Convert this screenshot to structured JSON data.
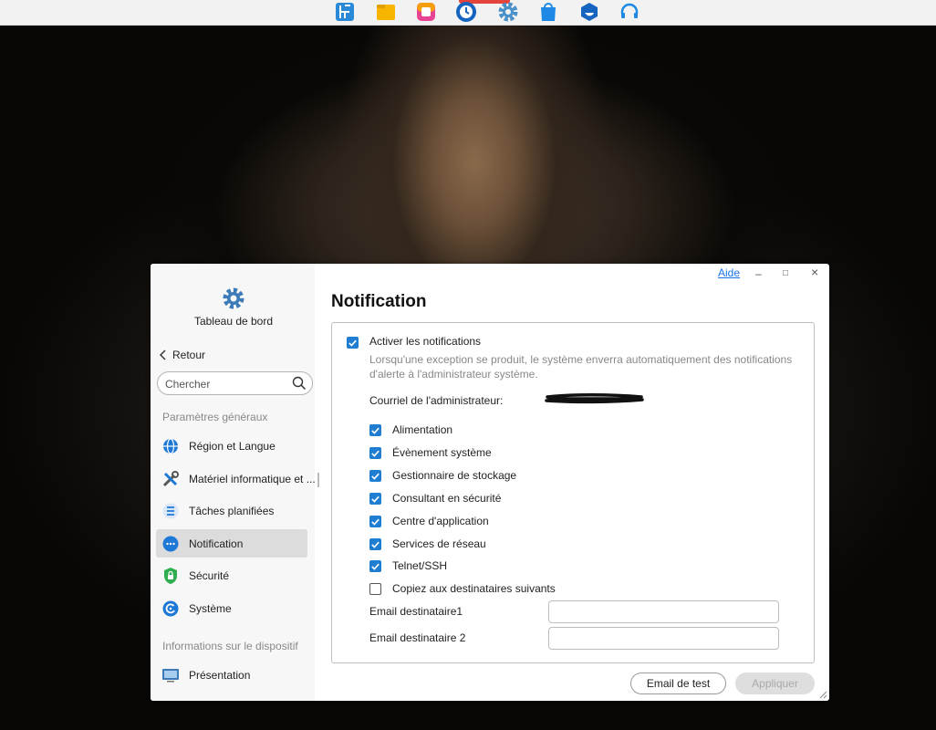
{
  "taskbar": {
    "icons": [
      "control-panel-icon",
      "file-manager-icon",
      "photos-icon",
      "clock-icon",
      "settings-icon",
      "app-center-icon",
      "docker-icon",
      "support-icon"
    ]
  },
  "window": {
    "help": "Aide",
    "minimize": "–",
    "maximize": "□",
    "close": "×"
  },
  "sidebar": {
    "app_title": "Tableau de bord",
    "back": "Retour",
    "search_placeholder": "Chercher",
    "section_general": "Paramètres généraux",
    "items": [
      {
        "label": "Région et Langue",
        "icon": "globe-icon"
      },
      {
        "label": "Matériel informatique et ...",
        "icon": "tools-icon"
      },
      {
        "label": "Tâches planifiées",
        "icon": "task-list-icon"
      },
      {
        "label": "Notification",
        "icon": "chat-bubble-icon",
        "active": true
      },
      {
        "label": "Sécurité",
        "icon": "shield-icon"
      },
      {
        "label": "Système",
        "icon": "system-icon"
      }
    ],
    "section_device": "Informations sur le dispositif",
    "device_items": [
      {
        "label": "Présentation",
        "icon": "monitor-icon"
      }
    ]
  },
  "main": {
    "title": "Notification",
    "enable_label": "Activer les notifications",
    "enable_checked": true,
    "description": "Lorsqu'une exception se produit, le système enverra automatiquement des notifications d'alerte à l'administrateur système.",
    "admin_email_label": "Courriel de l'administrateur:",
    "categories": [
      {
        "label": "Alimentation",
        "checked": true
      },
      {
        "label": "Évènement système",
        "checked": true
      },
      {
        "label": "Gestionnaire de stockage",
        "checked": true
      },
      {
        "label": "Consultant en sécurité",
        "checked": true
      },
      {
        "label": "Centre d'application",
        "checked": true
      },
      {
        "label": "Services de réseau",
        "checked": true
      },
      {
        "label": "Telnet/SSH",
        "checked": true
      },
      {
        "label": "Copiez aux destinataires suivants",
        "checked": false
      }
    ],
    "recipient1_label": "Email destinataire1",
    "recipient1_value": "",
    "recipient2_label": "Email destinataire 2",
    "recipient2_value": "",
    "test_button": "Email de test",
    "apply_button": "Appliquer"
  },
  "colors": {
    "accent": "#1f7ed1",
    "link": "#1a73e8"
  }
}
